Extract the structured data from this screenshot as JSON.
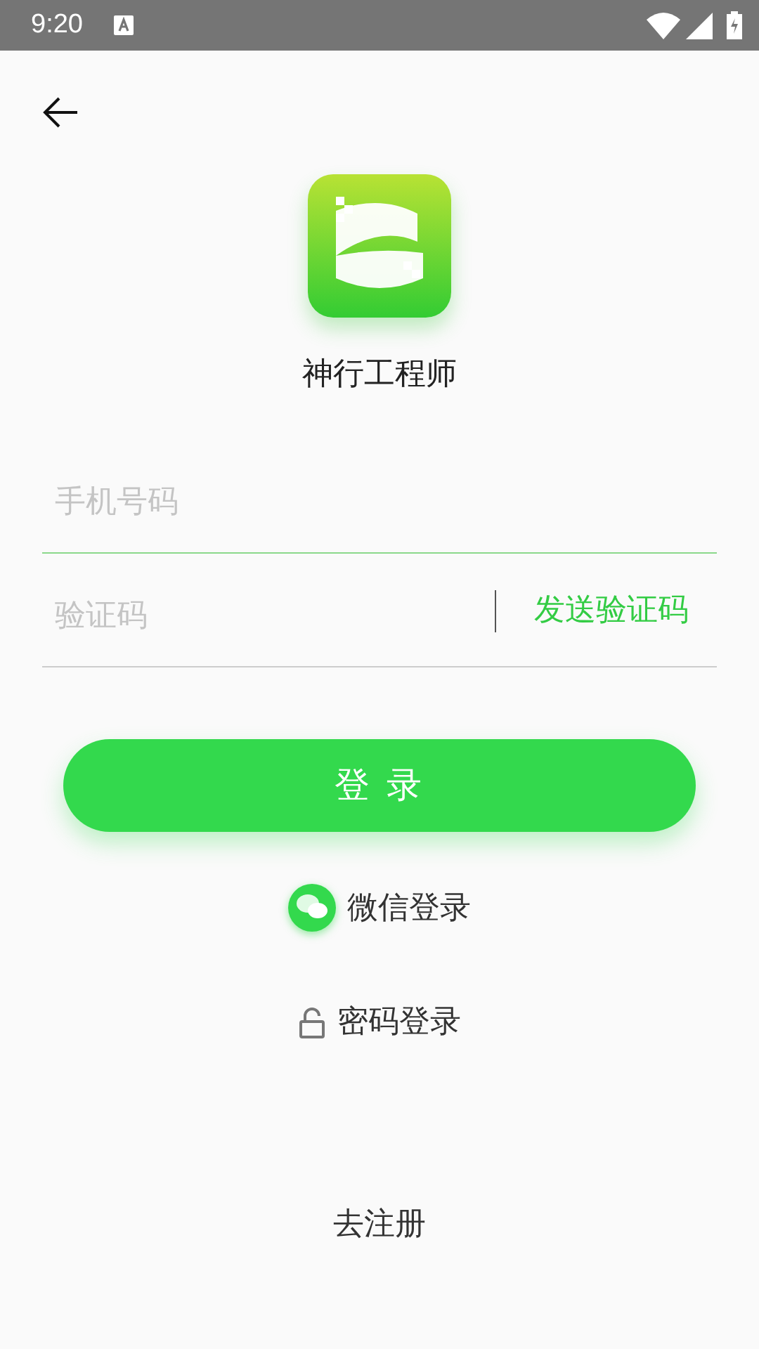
{
  "status_bar": {
    "time": "9:20"
  },
  "app": {
    "name": "神行工程师"
  },
  "fields": [
    {
      "kind": "phone",
      "placeholder": "手机号码",
      "focused": true
    },
    {
      "kind": "code",
      "placeholder": "验证码",
      "focused": false,
      "action": "发送验证码"
    }
  ],
  "login_button": "登 录",
  "alt_logins": [
    {
      "kind": "wechat",
      "label": "微信登录"
    },
    {
      "kind": "password",
      "label": "密码登录"
    }
  ],
  "register_link": "去注册"
}
